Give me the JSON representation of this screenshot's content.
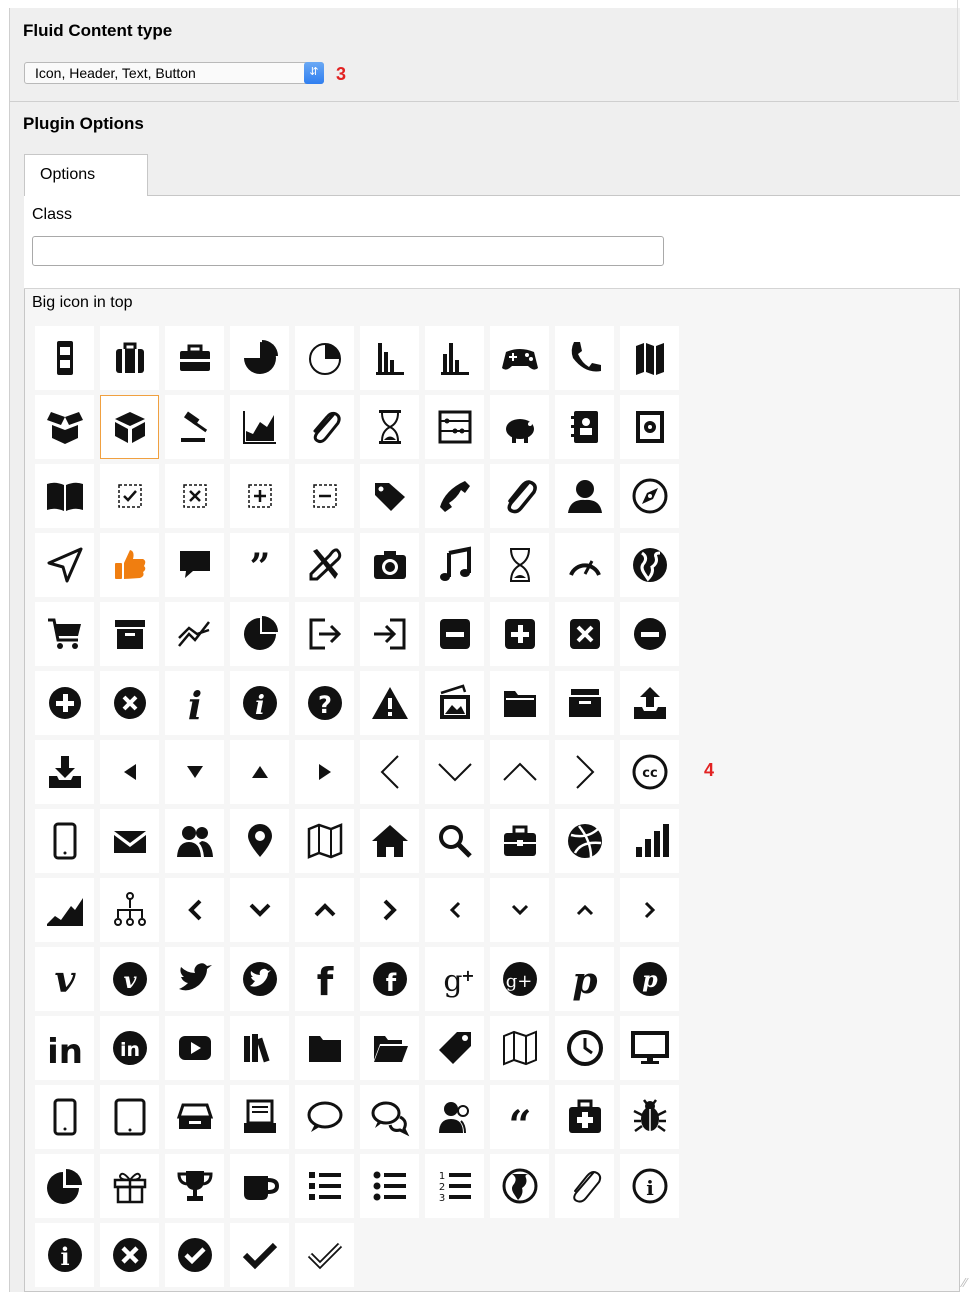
{
  "content_type": {
    "heading": "Fluid Content type",
    "selected_value": "Icon, Header, Text, Button",
    "callout": "3"
  },
  "plugin_options": {
    "heading": "Plugin Options",
    "tabs": [
      {
        "label": "Options"
      }
    ],
    "class_field": {
      "label": "Class",
      "value": ""
    },
    "icon_field": {
      "label": "Big icon in top",
      "callout": "4",
      "selected_index": 11
    }
  },
  "icons": [
    "file-cabinet-icon",
    "suitcase-icon",
    "toolbox-icon",
    "pie-chart-icon",
    "pie-chart-outline-icon",
    "bar-chart-icon",
    "bar-chart-alt-icon",
    "gamepad-icon",
    "phone-icon",
    "map-icon",
    "box-open-icon",
    "cube-icon",
    "gavel-icon",
    "chart-area-icon",
    "paperclip-icon",
    "hourglass-icon",
    "abacus-icon",
    "piggy-bank-icon",
    "address-book-icon",
    "safe-icon",
    "book-open-icon",
    "checkbox-checked-dashed-icon",
    "checkbox-x-dashed-icon",
    "checkbox-plus-dashed-icon",
    "checkbox-minus-dashed-icon",
    "tag-icon",
    "phone-handset-icon",
    "paperclip-alt-icon",
    "user-icon",
    "compass-icon",
    "navigation-arrow-icon",
    "thumbs-up-icon",
    "speech-bubble-icon",
    "quote-right-icon",
    "tools-icon",
    "camera-icon",
    "music-note-icon",
    "hourglass-outline-icon",
    "gauge-icon",
    "globe-icon",
    "shopping-cart-icon",
    "archive-icon",
    "line-chart-icon",
    "pie-chart-quarter-icon",
    "sign-out-icon",
    "sign-in-icon",
    "square-minus-icon",
    "square-plus-icon",
    "square-x-icon",
    "circle-minus-icon",
    "circle-plus-icon",
    "circle-x-icon",
    "info-italic-icon",
    "circle-info-icon",
    "circle-question-icon",
    "warning-icon",
    "pictures-icon",
    "folder-icon",
    "inbox-icon",
    "upload-icon",
    "download-icon",
    "caret-left-icon",
    "caret-down-icon",
    "caret-up-icon",
    "caret-right-icon",
    "chevron-left-thin-icon",
    "chevron-down-thin-icon",
    "chevron-up-thin-icon",
    "chevron-right-thin-icon",
    "creative-commons-icon",
    "mobile-icon",
    "envelope-icon",
    "users-icon",
    "map-marker-icon",
    "map-outline-icon",
    "home-icon",
    "search-icon",
    "briefcase-icon",
    "dribbble-icon",
    "signal-bars-icon",
    "area-chart-icon",
    "sitemap-icon",
    "chevron-left-icon",
    "chevron-down-icon",
    "chevron-up-icon",
    "chevron-right-icon",
    "chevron-left-small-icon",
    "chevron-down-small-icon",
    "chevron-up-small-icon",
    "chevron-right-small-icon",
    "vimeo-icon",
    "vimeo-circle-icon",
    "twitter-icon",
    "twitter-circle-icon",
    "facebook-icon",
    "facebook-circle-icon",
    "google-plus-icon",
    "google-plus-circle-icon",
    "pinterest-icon",
    "pinterest-circle-icon",
    "linkedin-icon",
    "linkedin-circle-icon",
    "youtube-icon",
    "books-icon",
    "folder-solid-icon",
    "folder-open-icon",
    "price-tag-icon",
    "map-fold-icon",
    "clock-icon",
    "monitor-icon",
    "phone-outline-icon",
    "tablet-icon",
    "drawer-icon",
    "document-stack-icon",
    "chat-bubble-icon",
    "chat-bubbles-icon",
    "user-group-icon",
    "quote-left-icon",
    "medical-kit-icon",
    "bug-icon",
    "pie-chart-slice-icon",
    "gift-icon",
    "trophy-icon",
    "coffee-icon",
    "list-icon",
    "list-bullets-icon",
    "list-numbered-icon",
    "globe-outline-icon",
    "paperclip-thin-icon",
    "circle-info-outline-icon",
    "info-solid-icon",
    "close-circle-icon",
    "check-circle-icon",
    "checkmark-icon",
    "checkmark-outline-icon"
  ]
}
